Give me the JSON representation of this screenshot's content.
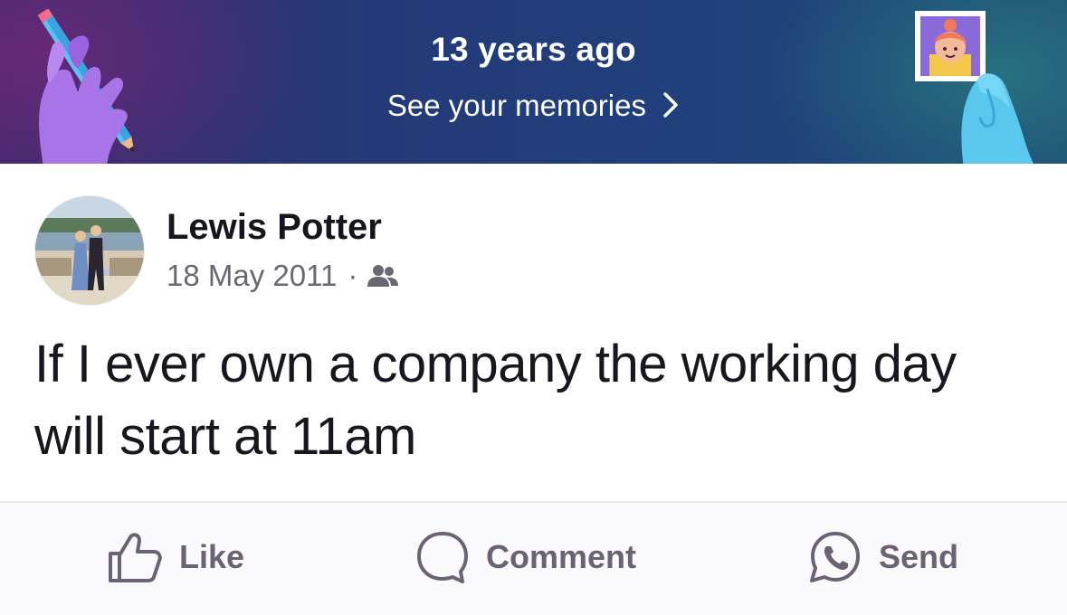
{
  "memories": {
    "title": "13 years ago",
    "link_label": "See your memories",
    "link_icon": "chevron-right-icon"
  },
  "post": {
    "author": "Lewis Potter",
    "date": "18 May 2011",
    "separator": "·",
    "audience_icon": "friends-icon",
    "text": "If I ever own a company the working day will start at 11am"
  },
  "actions": {
    "like": {
      "label": "Like",
      "icon": "thumbs-up-icon"
    },
    "comment": {
      "label": "Comment",
      "icon": "comment-bubble-icon"
    },
    "send": {
      "label": "Send",
      "icon": "whatsapp-icon"
    }
  },
  "colors": {
    "banner_start": "#3a2a6e",
    "banner_end": "#1f4a74",
    "text_primary": "#16151f",
    "text_secondary": "#6a6672",
    "action_text": "#6b6374"
  }
}
